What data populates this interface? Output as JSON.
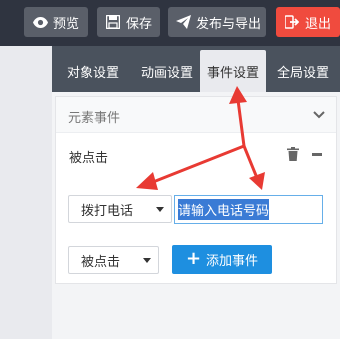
{
  "toolbar": {
    "preview_label": "预览",
    "save_label": "保存",
    "publish_label": "发布与导出",
    "exit_label": "退出"
  },
  "tabs": [
    {
      "label": "对象设置",
      "active": false
    },
    {
      "label": "动画设置",
      "active": false
    },
    {
      "label": "事件设置",
      "active": true
    },
    {
      "label": "全局设置",
      "active": false
    }
  ],
  "panel": {
    "title": "元素事件",
    "event_name": "被点击",
    "action_select": "拨打电话",
    "phone_placeholder": "请输入电话号码",
    "trigger_select": "被点击",
    "add_event_label": "添加事件"
  },
  "colors": {
    "topbar": "#2f3440",
    "tabsbar": "#4a525d",
    "exit_red": "#f04b3e",
    "add_blue": "#1e8fe0",
    "annotation_red": "#e83a33"
  }
}
